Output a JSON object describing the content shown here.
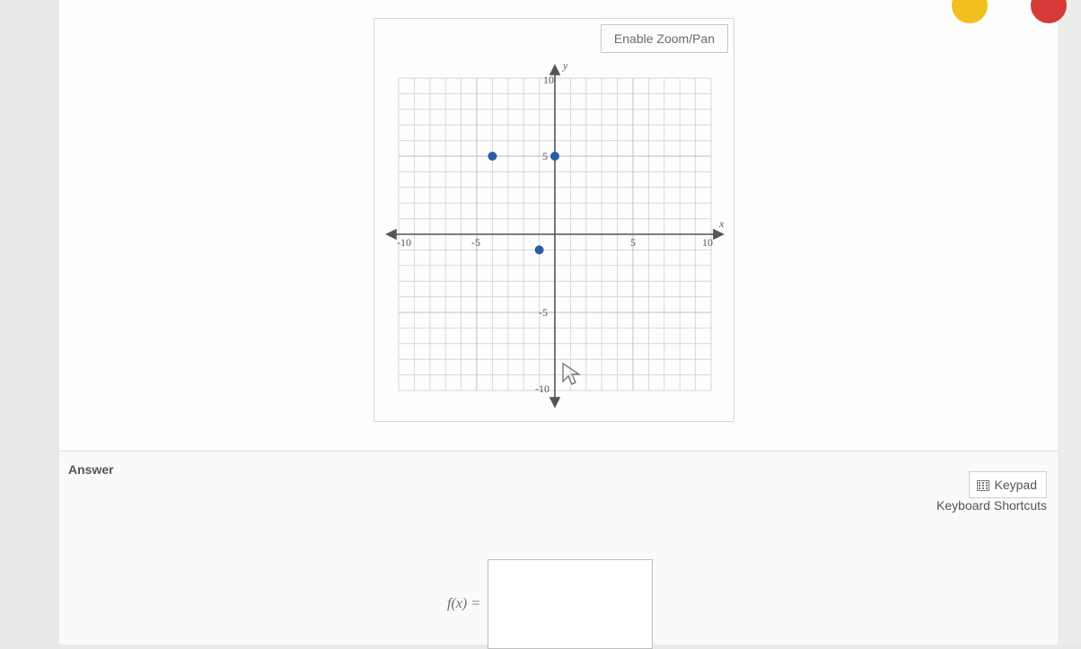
{
  "chart_panel": {
    "zoom_button_label": "Enable Zoom/Pan",
    "y_label": "y",
    "x_label": "x",
    "ticks": {
      "neg10": "-10",
      "neg5": "-5",
      "pos5": "5",
      "pos10": "10"
    }
  },
  "chart_data": {
    "type": "scatter",
    "title": "",
    "xlabel": "x",
    "ylabel": "y",
    "xlim": [
      -10,
      10
    ],
    "ylim": [
      -10,
      10
    ],
    "grid": true,
    "points": [
      {
        "x": -4,
        "y": 5
      },
      {
        "x": 0,
        "y": 5
      },
      {
        "x": -1,
        "y": -1
      }
    ]
  },
  "answer": {
    "heading": "Answer",
    "keypad_label": "Keypad",
    "keyboard_shortcuts_label": "Keyboard Shortcuts",
    "fx_label": "f(x) =",
    "fx_value": ""
  },
  "colors": {
    "point": "#2a5da6",
    "axis": "#555",
    "grid_minor": "#d7d7d5",
    "grid_major": "#bfbfbd"
  }
}
